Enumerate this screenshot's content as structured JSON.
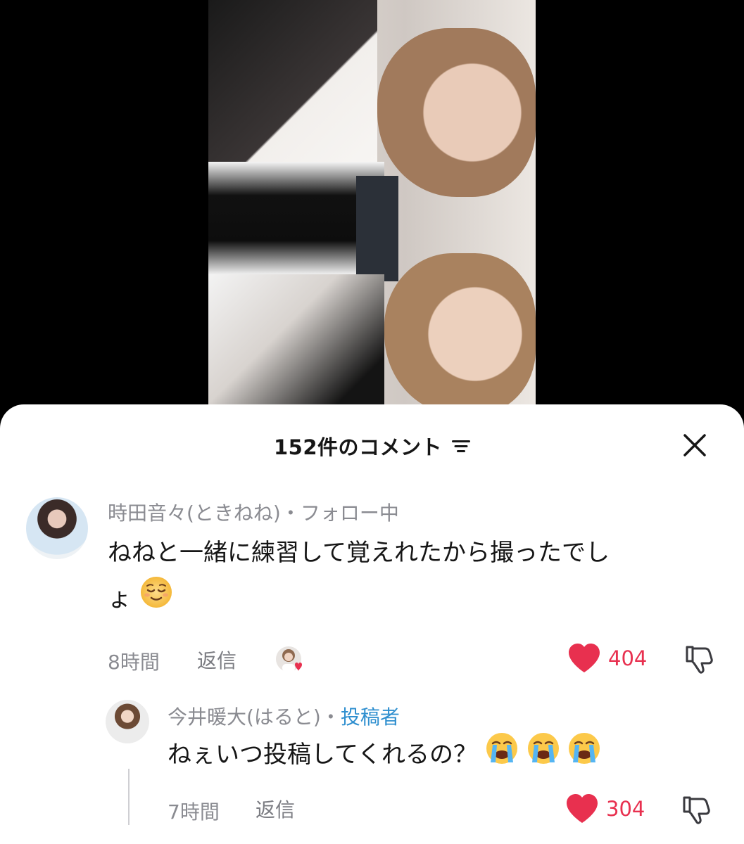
{
  "sheet": {
    "comment_count_label": "152件のコメント",
    "icons": {
      "sort": "filter-sort-icon",
      "close": "close-icon"
    }
  },
  "comments": [
    {
      "username": "時田音々(ときねね)",
      "separator": "・",
      "status": "フォロー中",
      "text_line1": "ねねと一緒に練習して覚えれたから撮ったでし",
      "text_line2": "ょ",
      "emoji": "relieved-face",
      "time": "8時間",
      "reply_label": "返信",
      "likes": "404",
      "liked_by_creator": true
    },
    {
      "username": "今井暖大(はると)",
      "separator": "・",
      "author_tag": "投稿者",
      "text": "ねぇいつ投稿してくれるの？",
      "emojis": [
        "loudly-crying-face",
        "loudly-crying-face",
        "loudly-crying-face"
      ],
      "time": "7時間",
      "reply_label": "返信",
      "likes": "304"
    }
  ],
  "colors": {
    "like": "#e8304f",
    "author_tag": "#2f8fcf",
    "muted": "#8a8b91",
    "text": "#161616"
  }
}
